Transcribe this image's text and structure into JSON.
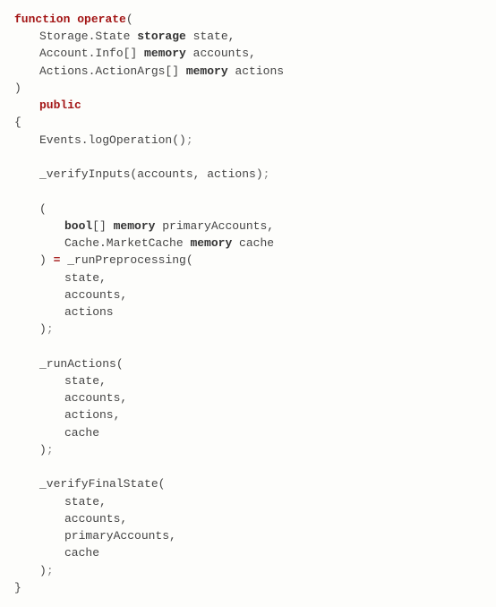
{
  "code": {
    "l1_kw": "function",
    "l1_fn": "operate",
    "l1_open": "(",
    "l2_a": "Storage.State ",
    "l2_b": "storage",
    "l2_c": " state,",
    "l3_a": "Account.Info[] ",
    "l3_b": "memory",
    "l3_c": " accounts,",
    "l4_a": "Actions.ActionArgs[] ",
    "l4_b": "memory",
    "l4_c": " actions",
    "l5": ")",
    "l6": "public",
    "l7": "{",
    "l8_a": "Events.logOperation()",
    "l8_b": ";",
    "l9_a": "_verifyInputs(accounts, actions)",
    "l9_b": ";",
    "l10": "(",
    "l11_a": "bool",
    "l11_b": "[] ",
    "l11_c": "memory",
    "l11_d": " primaryAccounts,",
    "l12_a": "Cache.MarketCache ",
    "l12_b": "memory",
    "l12_c": " cache",
    "l13_a": ") ",
    "l13_b": "=",
    "l13_c": " _runPreprocessing(",
    "l14": "state,",
    "l15": "accounts,",
    "l16": "actions",
    "l17_a": ")",
    "l17_b": ";",
    "l18": "_runActions(",
    "l19": "state,",
    "l20": "accounts,",
    "l21": "actions,",
    "l22": "cache",
    "l23_a": ")",
    "l23_b": ";",
    "l24": "_verifyFinalState(",
    "l25": "state,",
    "l26": "accounts,",
    "l27": "primaryAccounts,",
    "l28": "cache",
    "l29_a": ")",
    "l29_b": ";",
    "l30": "}"
  }
}
